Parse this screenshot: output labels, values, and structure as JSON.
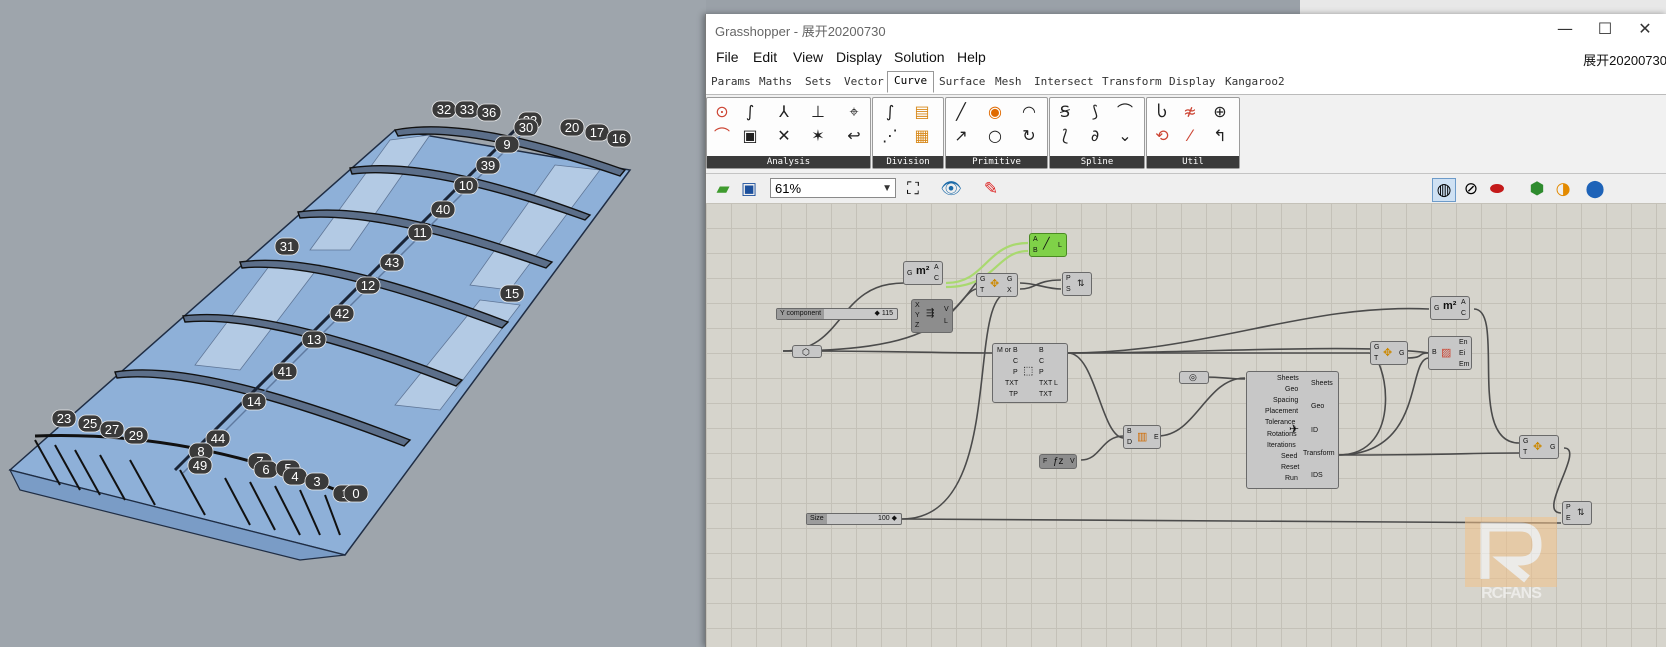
{
  "viewport": {
    "point_tags": [
      "32",
      "33",
      "36",
      "22",
      "30",
      "20",
      "17",
      "16",
      "9",
      "39",
      "10",
      "40",
      "11",
      "31",
      "43",
      "12",
      "15",
      "42",
      "13",
      "41",
      "14",
      "23",
      "25",
      "27",
      "29",
      "44",
      "8",
      "49",
      "7",
      "6",
      "5",
      "4",
      "3",
      "1",
      "0"
    ]
  },
  "window": {
    "title": "Grasshopper - 展开20200730",
    "doc_title": "展开20200730",
    "min": "—",
    "max": "☐",
    "close": "✕"
  },
  "menu": [
    "File",
    "Edit",
    "View",
    "Display",
    "Solution",
    "Help"
  ],
  "tabs": [
    "Params",
    "Maths",
    "Sets",
    "Vector",
    "Curve",
    "Surface",
    "Mesh",
    "Intersect",
    "Transform",
    "Display",
    "Kangaroo2"
  ],
  "active_tab": "Curve",
  "ribbon_groups": [
    "Analysis",
    "Division",
    "Primitive",
    "Spline",
    "Util"
  ],
  "toolbar": {
    "zoom": "61%"
  },
  "canvas": {
    "y_slider": {
      "name": "Y component",
      "value": "◆ 115"
    },
    "size_slider": {
      "name": "Size",
      "value": "100 ◆"
    },
    "node_area1": {
      "in": "G",
      "out_a": "A",
      "out_c": "C"
    },
    "node_green": {
      "a": "A",
      "b": "B",
      "out": "L"
    },
    "node_gt": {
      "g": "G",
      "t": "T",
      "outg": "G",
      "outx": "X"
    },
    "node_ps": {
      "p": "P",
      "s": "S"
    },
    "node_xyz": {
      "x": "X",
      "y": "Y",
      "z": "Z",
      "v": "V",
      "l": "L"
    },
    "node_text": {
      "in": [
        "M or B",
        "C",
        "P",
        "TXT",
        "TP"
      ],
      "out": [
        "B",
        "C",
        "P",
        "TXT L",
        "TXT"
      ]
    },
    "node_bd": {
      "b": "B",
      "d": "D",
      "e": "E"
    },
    "node_fv": {
      "f": "F",
      "v": "V"
    },
    "node_pack": {
      "in": [
        "Sheets",
        "Geo",
        "Spacing",
        "Placement",
        "Tolerance",
        "Rotations",
        "Iterations",
        "Seed",
        "Reset",
        "Run"
      ],
      "out": [
        "Sheets",
        "Geo",
        "ID",
        "Transform",
        "IDS"
      ]
    },
    "node_area2": {
      "in": "G",
      "out_a": "A",
      "out_c": "C"
    },
    "node_gt2": {
      "g": "G",
      "t": "T",
      "out": "G"
    },
    "node_box": {
      "b": "B",
      "out": [
        "En",
        "Ei",
        "Em"
      ]
    },
    "node_gt3": {
      "g": "G",
      "t": "T",
      "out": "G"
    },
    "node_pe": {
      "p": "P",
      "e": "E"
    }
  },
  "watermark": "RCFANS"
}
